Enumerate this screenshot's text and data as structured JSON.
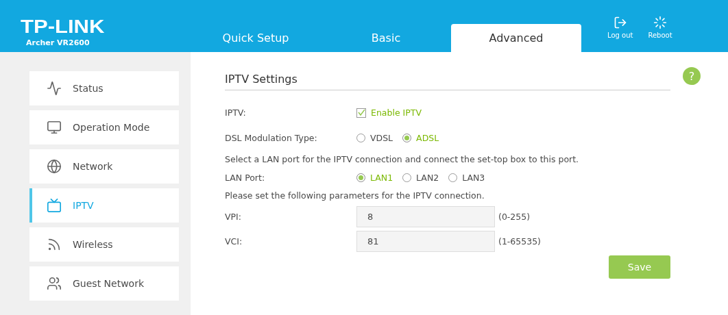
{
  "header": {
    "logo": "TP-LINK",
    "model": "Archer VR2600",
    "tabs": [
      {
        "label": "Quick Setup",
        "selected": false
      },
      {
        "label": "Basic",
        "selected": false
      },
      {
        "label": "Advanced",
        "selected": true
      }
    ],
    "actions": [
      {
        "kind": "logout",
        "label": "Log out"
      },
      {
        "kind": "reboot",
        "label": "Reboot"
      }
    ]
  },
  "sidebar": {
    "items": [
      {
        "kind": "status",
        "label": "Status",
        "selected": false
      },
      {
        "kind": "operation",
        "label": "Operation Mode",
        "selected": false
      },
      {
        "kind": "network",
        "label": "Network",
        "selected": false
      },
      {
        "kind": "iptv",
        "label": "IPTV",
        "selected": true
      },
      {
        "kind": "wireless",
        "label": "Wireless",
        "selected": false
      },
      {
        "kind": "guest",
        "label": "Guest Network",
        "selected": false
      }
    ]
  },
  "content": {
    "title": "IPTV Settings",
    "help": "?",
    "rows": [
      {
        "kind": "checkbox",
        "label": "IPTV:",
        "option": {
          "label": "Enable IPTV",
          "checked": true
        }
      },
      {
        "kind": "radio",
        "label": "DSL Modulation Type:",
        "options": [
          {
            "label": "VDSL",
            "selected": false
          },
          {
            "label": "ADSL",
            "selected": true
          }
        ]
      },
      {
        "kind": "note",
        "text": "Select a LAN port for the IPTV connection and connect the set-top box to this port."
      },
      {
        "kind": "radio",
        "label": "LAN Port:",
        "options": [
          {
            "label": "LAN1",
            "selected": true
          },
          {
            "label": "LAN2",
            "selected": false
          },
          {
            "label": "LAN3",
            "selected": false
          }
        ]
      },
      {
        "kind": "note",
        "text": "Please set the following parameters for the IPTV connection."
      },
      {
        "kind": "input",
        "label": "VPI:",
        "value": "8",
        "hint": "(0-255)"
      },
      {
        "kind": "input",
        "label": "VCI:",
        "value": "81",
        "hint": "(1-65535)"
      }
    ],
    "save": "Save"
  }
}
